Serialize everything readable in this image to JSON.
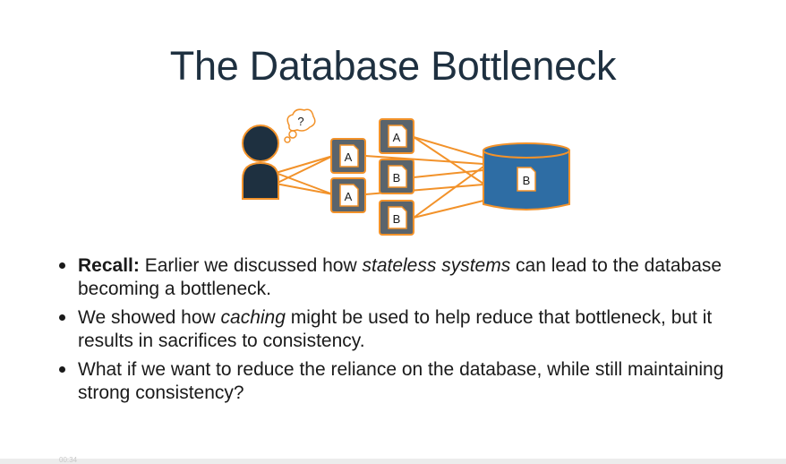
{
  "slide": {
    "title": "The Database Bottleneck"
  },
  "diagram": {
    "thought_bubble_label": "?",
    "left_docs": [
      "A",
      "A"
    ],
    "right_docs": [
      "A",
      "B",
      "B"
    ],
    "database_doc": "B",
    "colors": {
      "navy": "#1e3040",
      "orange": "#f2922a",
      "server_gray": "#5a646c",
      "db_blue": "#2e6da4"
    }
  },
  "bullets": [
    {
      "lead": "Recall:",
      "segments": [
        {
          "text": " Earlier we discussed how ",
          "style": "normal"
        },
        {
          "text": "stateless systems",
          "style": "italic"
        },
        {
          "text": " can lead to the database becoming a bottleneck.",
          "style": "normal"
        }
      ]
    },
    {
      "segments": [
        {
          "text": "We showed how ",
          "style": "normal"
        },
        {
          "text": "caching",
          "style": "italic"
        },
        {
          "text": " might be used to help reduce that bottleneck, but it results in sacrifices to consistency.",
          "style": "normal"
        }
      ]
    },
    {
      "segments": [
        {
          "text": "What if we want to reduce the reliance on the database, while still maintaining strong consistency?",
          "style": "normal"
        }
      ]
    }
  ],
  "player": {
    "timestamp": "00:34"
  }
}
